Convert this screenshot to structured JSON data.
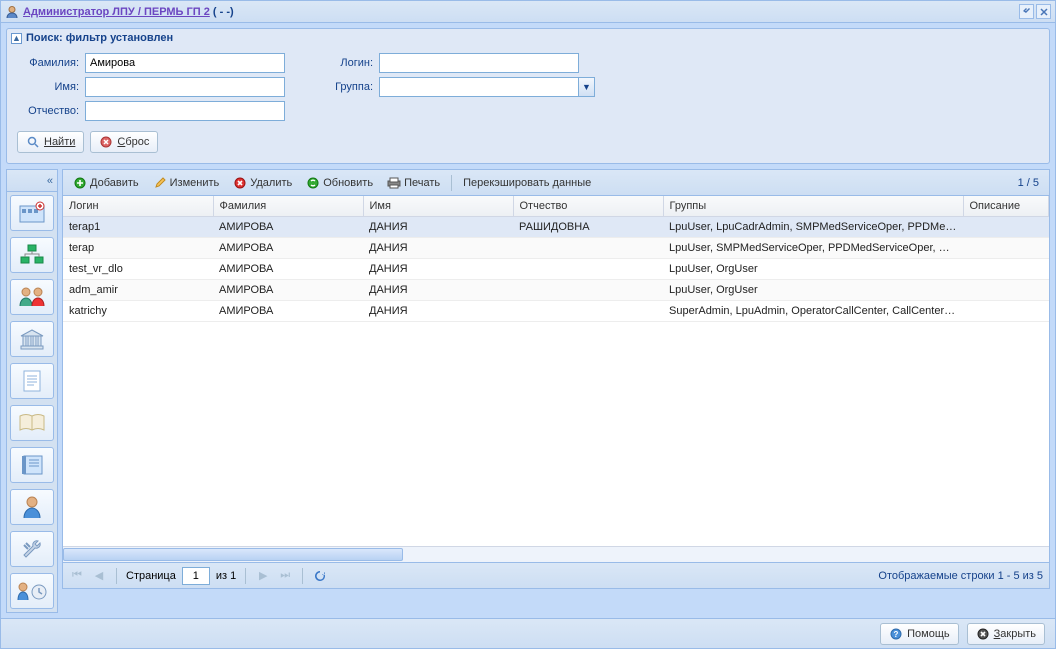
{
  "title": {
    "link": "Администратор ЛПУ / ПЕРМЬ ГП 2",
    "suffix": "( - -)"
  },
  "search": {
    "header": "Поиск: фильтр установлен",
    "labels": {
      "surname": "Фамилия:",
      "name": "Имя:",
      "patronymic": "Отчество:",
      "login": "Логин:",
      "group": "Группа:"
    },
    "values": {
      "surname": "Амирова",
      "name": "",
      "patronymic": "",
      "login": "",
      "group": ""
    },
    "buttons": {
      "find": "Найти",
      "reset": "Сброс"
    }
  },
  "toolbar": {
    "add": "Добавить",
    "edit": "Изменить",
    "delete": "Удалить",
    "refresh": "Обновить",
    "print": "Печать",
    "recache": "Перекэшировать данные",
    "counter": "1 / 5"
  },
  "columns": {
    "login": "Логин",
    "surname": "Фамилия",
    "name": "Имя",
    "patronymic": "Отчество",
    "groups": "Группы",
    "description": "Описание"
  },
  "rows": [
    {
      "login": "terap1",
      "surname": "АМИРОВА",
      "name": "ДАНИЯ",
      "patronymic": "РАШИДОВНА",
      "groups": "LpuUser, LpuCadrAdmin, SMPMedServiceOper, PPDMedS...",
      "description": ""
    },
    {
      "login": "terap",
      "surname": "АМИРОВА",
      "name": "ДАНИЯ",
      "patronymic": "",
      "groups": "LpuUser, SMPMedServiceOper, PPDMedServiceOper, Org...",
      "description": ""
    },
    {
      "login": "test_vr_dlo",
      "surname": "АМИРОВА",
      "name": "ДАНИЯ",
      "patronymic": "",
      "groups": "LpuUser, OrgUser",
      "description": ""
    },
    {
      "login": "adm_amir",
      "surname": "АМИРОВА",
      "name": "ДАНИЯ",
      "patronymic": "",
      "groups": "LpuUser, OrgUser",
      "description": ""
    },
    {
      "login": "katrichy",
      "surname": "АМИРОВА",
      "name": "ДАНИЯ",
      "patronymic": "",
      "groups": "SuperAdmin, LpuAdmin, OperatorCallCenter, CallCenterAd...",
      "description": ""
    }
  ],
  "paging": {
    "page_label": "Страница",
    "page_value": "1",
    "of_label": "из 1",
    "display": "Отображаемые строки 1 - 5 из 5"
  },
  "footer": {
    "help": "Помощь",
    "close": "Закрыть"
  }
}
